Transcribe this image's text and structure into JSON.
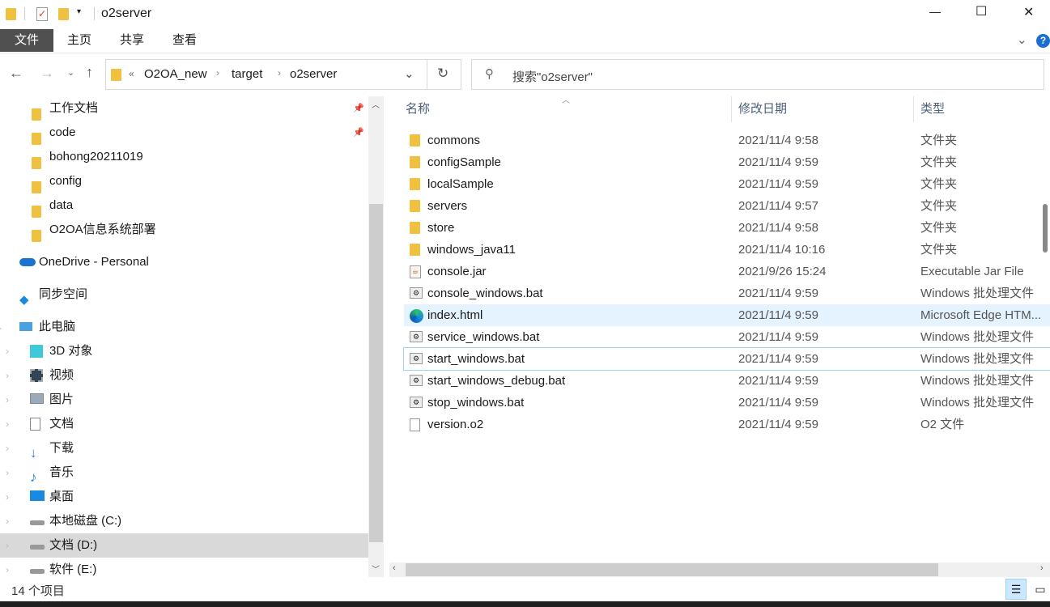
{
  "window": {
    "title": "o2server",
    "minimize": "—",
    "maximize": "☐",
    "close": "✕"
  },
  "ribbon": {
    "tabs": [
      "文件",
      "主页",
      "共享",
      "查看"
    ],
    "help": "?",
    "expand": "⌄"
  },
  "address": {
    "overflow": "«",
    "crumbs": [
      "O2OA_new",
      "target",
      "o2server"
    ],
    "search_placeholder": "搜索\"o2server\""
  },
  "nav": {
    "quick": [
      "工作文档",
      "code",
      "bohong20211019",
      "config",
      "data",
      "O2OA信息系统部署"
    ],
    "onedrive": "OneDrive - Personal",
    "sync": "同步空间",
    "pc": "此电脑",
    "pc_items": [
      "3D 对象",
      "视频",
      "图片",
      "文档",
      "下载",
      "音乐",
      "桌面",
      "本地磁盘 (C:)",
      "文档 (D:)",
      "软件 (E:)"
    ]
  },
  "columns": {
    "name": "名称",
    "date": "修改日期",
    "type": "类型"
  },
  "files": [
    {
      "name": "commons",
      "date": "2021/11/4 9:58",
      "type": "文件夹",
      "icon": "folder"
    },
    {
      "name": "configSample",
      "date": "2021/11/4 9:59",
      "type": "文件夹",
      "icon": "folder"
    },
    {
      "name": "localSample",
      "date": "2021/11/4 9:59",
      "type": "文件夹",
      "icon": "folder"
    },
    {
      "name": "servers",
      "date": "2021/11/4 9:57",
      "type": "文件夹",
      "icon": "folder"
    },
    {
      "name": "store",
      "date": "2021/11/4 9:58",
      "type": "文件夹",
      "icon": "folder"
    },
    {
      "name": "windows_java11",
      "date": "2021/11/4 10:16",
      "type": "文件夹",
      "icon": "folder"
    },
    {
      "name": "console.jar",
      "date": "2021/9/26 15:24",
      "type": "Executable Jar File",
      "icon": "jar"
    },
    {
      "name": "console_windows.bat",
      "date": "2021/11/4 9:59",
      "type": "Windows 批处理文件",
      "icon": "bat"
    },
    {
      "name": "index.html",
      "date": "2021/11/4 9:59",
      "type": "Microsoft Edge HTM...",
      "icon": "edge"
    },
    {
      "name": "service_windows.bat",
      "date": "2021/11/4 9:59",
      "type": "Windows 批处理文件",
      "icon": "bat"
    },
    {
      "name": "start_windows.bat",
      "date": "2021/11/4 9:59",
      "type": "Windows 批处理文件",
      "icon": "bat"
    },
    {
      "name": "start_windows_debug.bat",
      "date": "2021/11/4 9:59",
      "type": "Windows 批处理文件",
      "icon": "bat"
    },
    {
      "name": "stop_windows.bat",
      "date": "2021/11/4 9:59",
      "type": "Windows 批处理文件",
      "icon": "bat"
    },
    {
      "name": "version.o2",
      "date": "2021/11/4 9:59",
      "type": "O2 文件",
      "icon": "file"
    }
  ],
  "status": {
    "count": "14 个项目"
  },
  "colors": {
    "hover": "#e5f3ff",
    "focus": "#99d1ff",
    "file_tab": "#505050"
  }
}
